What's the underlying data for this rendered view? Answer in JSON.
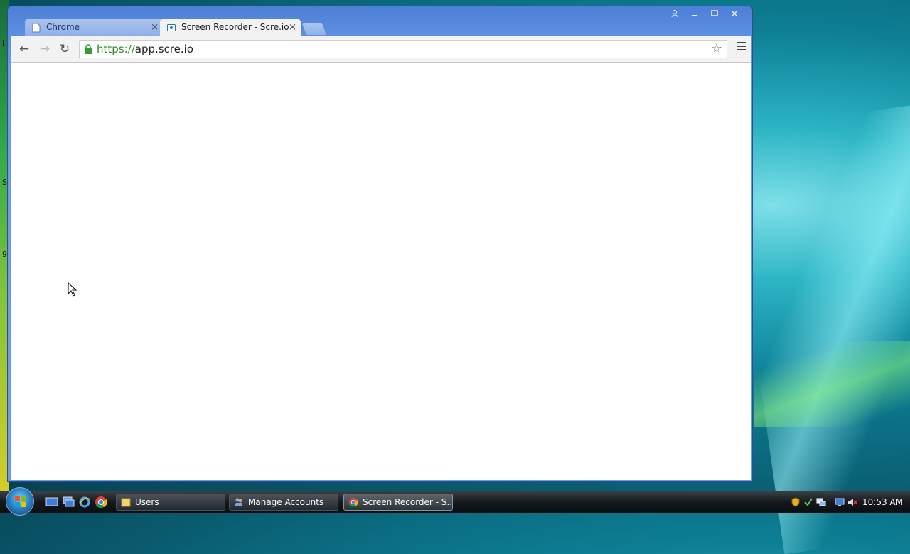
{
  "browser": {
    "tabs": [
      {
        "label": "Chrome",
        "active": false
      },
      {
        "label": "Screen Recorder - Scre.io",
        "active": true
      }
    ],
    "close_symbol": "×",
    "nav": {
      "back": "←",
      "forward": "→",
      "reload": "↻"
    },
    "address": {
      "scheme": "https://",
      "host": "app.scre.io"
    },
    "star_symbol": "☆",
    "icons": {
      "lock": "lock-icon",
      "star": "star-icon",
      "menu": "menu-icon"
    }
  },
  "desktop_edge_text": [
    "I",
    "S",
    "9"
  ],
  "taskbar": {
    "tasks": [
      {
        "label": "Users"
      },
      {
        "label": "Manage Accounts"
      },
      {
        "label": "Screen Recorder - S..."
      }
    ],
    "clock": "10:53 AM"
  },
  "colors": {
    "titlebar": "#5c8fe2",
    "url_scheme": "#2e8b2e",
    "taskbar": "#15191d"
  }
}
